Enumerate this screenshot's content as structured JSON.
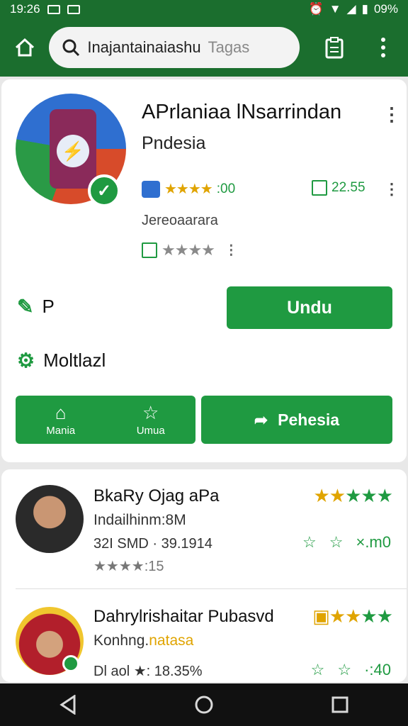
{
  "status": {
    "time": "19:26",
    "battery": "09%"
  },
  "appbar": {
    "search_text": "Inajantainaiashu",
    "search_hint": "Tagas"
  },
  "app": {
    "title": "APrlaniaa lNsarrindan",
    "subtitle": "Pndesia",
    "rating_text": ":00",
    "size_text": "22.55",
    "developer": "Jereoaarara",
    "label_p": "P",
    "label_mode": "Moltlazl",
    "install_label": "Undu",
    "btn1_label": "Mania",
    "btn2_label": "Umua",
    "share_label": "Pehesia",
    "colors": {
      "accent": "#1f9a41",
      "bar": "#1b6e2e"
    }
  },
  "reviews": [
    {
      "name": "BkaRy Ojag aPa",
      "sub": "Indailhinm:8M",
      "meta": "32I SMD · 39.1914",
      "rating_line": "★★★★:15",
      "count": "×.m0"
    },
    {
      "name": "Dahrylrishaitar Pubasvd",
      "sub_a": "Konhng.",
      "sub_b": "natasa",
      "meta": "Dl aol ★: 18.35%",
      "count": "·:40"
    }
  ],
  "icons": [
    "home-icon",
    "search-icon",
    "clipboard-icon",
    "more-icon",
    "back-icon",
    "home-circle-icon",
    "recents-icon"
  ]
}
